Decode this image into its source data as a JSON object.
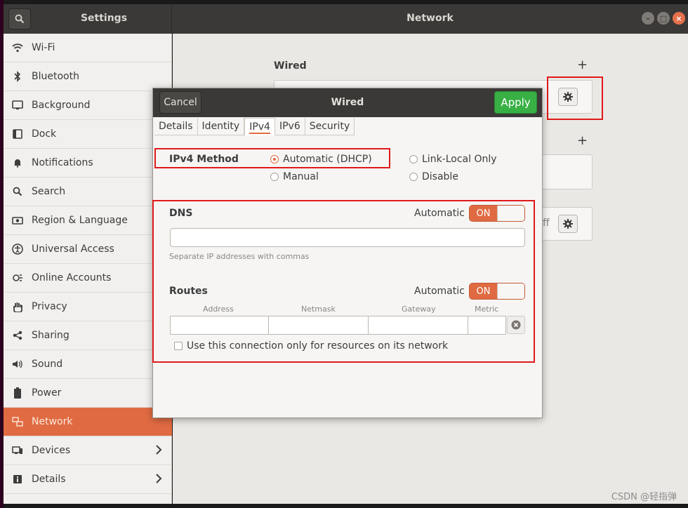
{
  "header": {
    "left_title": "Settings",
    "right_title": "Network"
  },
  "sidebar": {
    "items": [
      {
        "label": "Wi-Fi"
      },
      {
        "label": "Bluetooth"
      },
      {
        "label": "Background"
      },
      {
        "label": "Dock"
      },
      {
        "label": "Notifications"
      },
      {
        "label": "Search"
      },
      {
        "label": "Region & Language"
      },
      {
        "label": "Universal Access"
      },
      {
        "label": "Online Accounts"
      },
      {
        "label": "Privacy"
      },
      {
        "label": "Sharing"
      },
      {
        "label": "Sound"
      },
      {
        "label": "Power"
      },
      {
        "label": "Network"
      },
      {
        "label": "Devices"
      },
      {
        "label": "Details"
      }
    ],
    "active": "Network"
  },
  "main": {
    "wired_label": "Wired",
    "off_text": "ff"
  },
  "dialog": {
    "cancel_label": "Cancel",
    "title": "Wired",
    "apply_label": "Apply",
    "tabs": [
      "Details",
      "Identity",
      "IPv4",
      "IPv6",
      "Security"
    ],
    "active_tab": "IPv4",
    "ipv4_method_label": "IPv4 Method",
    "methods": {
      "automatic": "Automatic (DHCP)",
      "link_local": "Link-Local Only",
      "manual": "Manual",
      "disable": "Disable"
    },
    "selected_method": "Automatic (DHCP)",
    "dns": {
      "label": "DNS",
      "automatic_label": "Automatic",
      "switch_label": "ON",
      "value": "",
      "hint": "Separate IP addresses with commas"
    },
    "routes": {
      "label": "Routes",
      "automatic_label": "Automatic",
      "switch_label": "ON",
      "columns": [
        "Address",
        "Netmask",
        "Gateway",
        "Metric"
      ]
    },
    "only_resources_label": "Use this connection only for resources on its network"
  },
  "watermark": "CSDN @轻指弹",
  "colors": {
    "accent": "#e06b42",
    "apply_green": "#38b044",
    "highlight_red": "#e0191a",
    "headerbar": "#3b3937"
  }
}
